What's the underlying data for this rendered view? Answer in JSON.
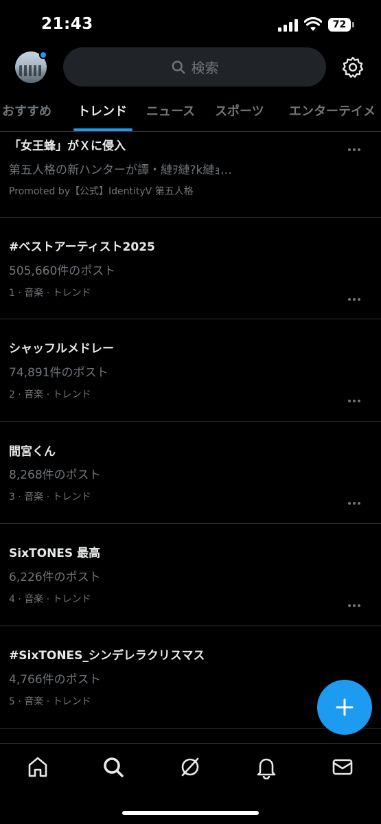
{
  "status_bar": {
    "time": "21:43",
    "battery": "72",
    "icons": [
      "signal-icon",
      "wifi-icon",
      "battery-icon"
    ]
  },
  "header": {
    "search_placeholder": "検索",
    "icons": [
      "search-icon",
      "gear-icon"
    ]
  },
  "tabs": [
    {
      "label": "おすすめ",
      "active": false
    },
    {
      "label": "トレンド",
      "active": true
    },
    {
      "label": "ニュース",
      "active": false
    },
    {
      "label": "スポーツ",
      "active": false
    },
    {
      "label": "エンターテイメ",
      "active": false
    }
  ],
  "trends": [
    {
      "title": "「女王蜂」がＸに侵入",
      "subtitle": "第五人格の新ハンターが譚・縺ｦ縺?k縺ｮ…",
      "meta": "Promoted by【公式】IdentityV 第五人格"
    },
    {
      "title": "#ベストアーティスト2025",
      "subtitle": "505,660件のポスト",
      "meta": "1 · 音楽 · トレンド"
    },
    {
      "title": "シャッフルメドレー",
      "subtitle": "74,891件のポスト",
      "meta": "2 · 音楽 · トレンド"
    },
    {
      "title": "間宮くん",
      "subtitle": "8,268件のポスト",
      "meta": "3 · 音楽 · トレンド"
    },
    {
      "title": "SixTONES 最高",
      "subtitle": "6,226件のポスト",
      "meta": "4 · 音楽 · トレンド"
    },
    {
      "title": "#SixTONES_シンデレラクリスマス",
      "subtitle": "4,766件のポスト",
      "meta": "5 · 音楽 · トレンド"
    }
  ],
  "bottom_nav": [
    "home-icon",
    "explore-icon",
    "grok-icon",
    "notifications-icon",
    "messages-icon"
  ],
  "colors": {
    "accent": "#1d9bf0",
    "background": "#000000",
    "text": "#e7e9ea",
    "secondary_text": "#71767b",
    "divider": "#2f3336"
  }
}
